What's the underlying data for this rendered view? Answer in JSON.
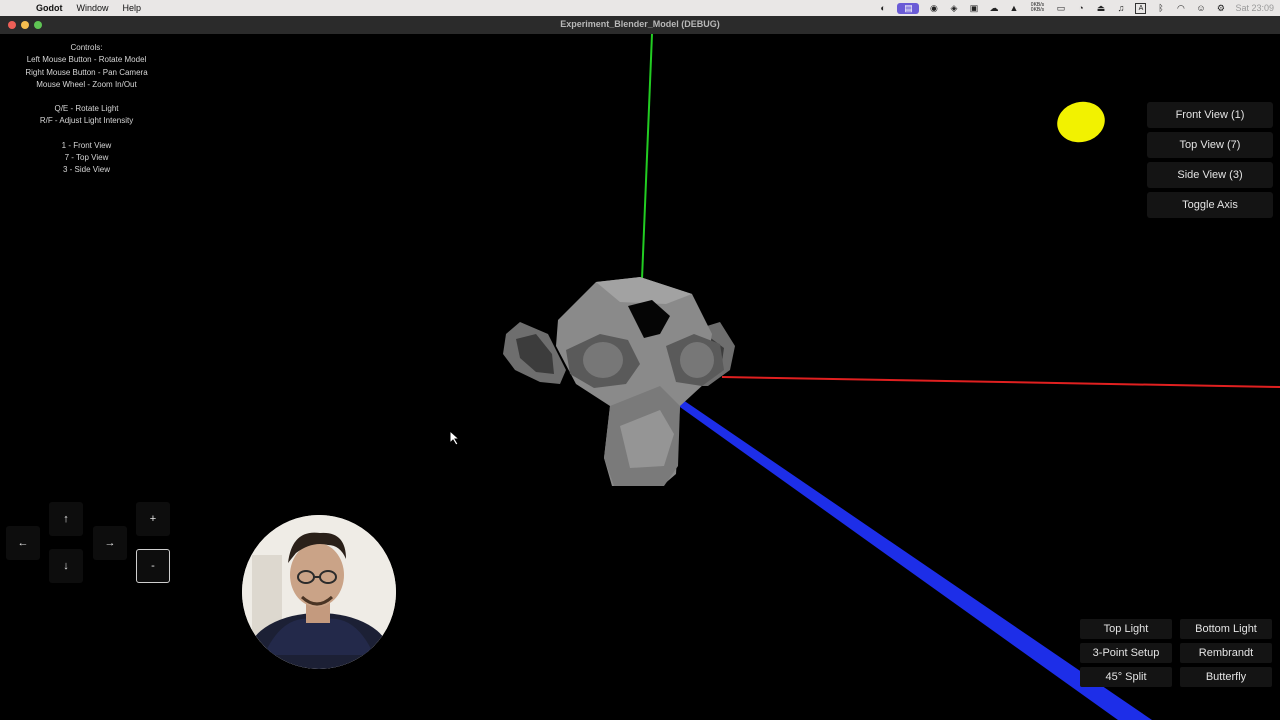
{
  "menubar": {
    "app_name": "Godot",
    "items": [
      "Window",
      "Help"
    ],
    "status": {
      "net_up": "0KB/s",
      "net_down": "0KB/s",
      "clock": "Sat 23:09"
    }
  },
  "window": {
    "title": "Experiment_Blender_Model (DEBUG)",
    "traffic_lights": [
      "#ed5f57",
      "#f5bd4f",
      "#5fc454"
    ]
  },
  "help": {
    "heading": "Controls:",
    "lines": [
      "Left Mouse Button - Rotate Model",
      "Right Mouse Button - Pan Camera",
      "Mouse Wheel - Zoom In/Out",
      "",
      "Q/E - Rotate Light",
      "R/F - Adjust Light Intensity",
      "",
      "1 - Front View",
      "7 - Top View",
      "3 - Side View"
    ]
  },
  "view_buttons": [
    "Front View (1)",
    "Top View (7)",
    "Side View (3)",
    "Toggle Axis"
  ],
  "light_buttons": [
    "Top Light",
    "Bottom Light",
    "3-Point Setup",
    "Rembrandt",
    "45° Split",
    "Butterfly"
  ],
  "nav_pad": {
    "up": "↑",
    "down": "↓",
    "left": "←",
    "right": "→",
    "zoom_in": "+",
    "zoom_out": "-"
  },
  "colors": {
    "x_axis": "#e02020",
    "y_axis": "#22cc22",
    "z_axis": "#1d2ee8",
    "light_gizmo": "#f2f200",
    "model": "#808080"
  }
}
